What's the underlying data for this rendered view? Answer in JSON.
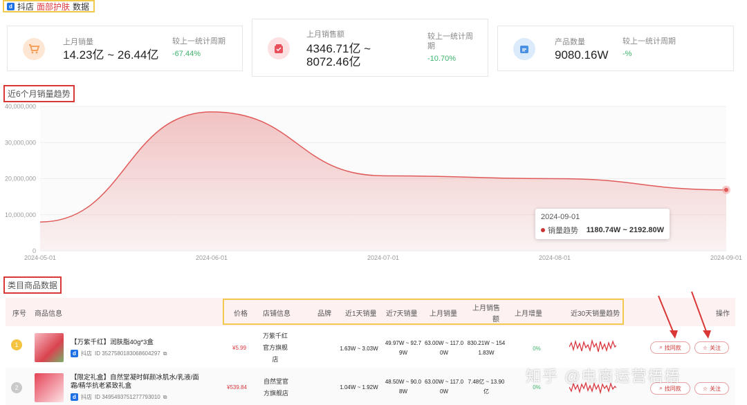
{
  "header": {
    "platform": "抖店",
    "category": "面部护肤",
    "suffix": "数据"
  },
  "stats": [
    {
      "label": "上月销量",
      "value": "14.23亿 ~ 26.44亿",
      "compare_label": "较上一统计周期",
      "compare_value": "-67.44%",
      "icon": "cart-icon",
      "color": "#f5a05a"
    },
    {
      "label": "上月销售额",
      "value_line1": "4346.71亿 ~",
      "value_line2": "8072.46亿",
      "compare_label_line1": "较上一统计周",
      "compare_label_line2": "期",
      "compare_value": "-10.70%",
      "icon": "bag-icon",
      "color": "#e8505b"
    },
    {
      "label": "产品数量",
      "value": "9080.16W",
      "compare_label": "较上一统计周期",
      "compare_value": "-%",
      "icon": "box-icon",
      "color": "#4a90e2"
    }
  ],
  "trend_section": {
    "title": "近6个月销量趋势"
  },
  "chart_data": {
    "type": "area",
    "title": "近6个月销量趋势",
    "x": [
      "2024-05-01",
      "2024-06-01",
      "2024-07-01",
      "2024-08-01",
      "2024-09-01"
    ],
    "y_ticks": [
      "40,000,000",
      "30,000,000",
      "20,000,000",
      "10,000,000",
      "0"
    ],
    "ylim": [
      0,
      40000000
    ],
    "series": [
      {
        "values": [
          8000000,
          38500000,
          20800000,
          20000000,
          16900000
        ]
      }
    ],
    "tooltip": {
      "date": "2024-09-01",
      "series_label": "销量趋势",
      "value": "1180.74W ~ 2192.80W"
    },
    "grid": true,
    "color": "#e05a5a"
  },
  "table_section": {
    "title": "类目商品数据",
    "columns": [
      "序号",
      "商品信息",
      "价格",
      "店铺信息",
      "品牌",
      "近1天销量",
      "近7天销量",
      "上月销量",
      "上月销售",
      "额",
      "上月增量",
      "近30天销量趋势",
      "操作"
    ],
    "rows": [
      {
        "rank": "1",
        "name_line1": "【万紫千红】润肤脂40g*3盒",
        "name_line2": "",
        "shop_platform": "抖店",
        "id": "ID 3527580183068604297",
        "price": "¥5.99",
        "shop_lines": [
          "万紫千红",
          "官方旗舰",
          "店"
        ],
        "brand": "",
        "day1": "1.63W ~ 3.03W",
        "day7_line1": "49.97W ~ 92.7",
        "day7_line2": "9W",
        "month_sales_line1": "63.00W ~ 117.0",
        "month_sales_line2": "0W",
        "month_gmv_line1": "830.21W ~ 154",
        "month_gmv_line2": "1.83W",
        "growth": "0%",
        "btn_similar": "找同款",
        "btn_follow": "关注"
      },
      {
        "rank": "2",
        "name_line1": "【限定礼盒】自然堂凝时鲜颜冰肌水/乳液/面",
        "name_line2": "霜/精华抗老紧致礼盒",
        "shop_platform": "抖店",
        "id": "ID 3495493751277793010",
        "price": "¥539.84",
        "shop_lines": [
          "自然堂官",
          "方旗舰店"
        ],
        "brand": "",
        "day1": "1.04W ~ 1.92W",
        "day7_line1": "48.50W ~ 90.0",
        "day7_line2": "8W",
        "month_sales_line1": "63.00W ~ 117.0",
        "month_sales_line2": "0W",
        "month_gmv_line1": "7.48亿 ~ 13.90",
        "month_gmv_line2": "亿",
        "growth": "0%",
        "btn_similar": "找同款",
        "btn_follow": "关注"
      }
    ]
  },
  "watermark": "知乎 @电商运营梧梧"
}
